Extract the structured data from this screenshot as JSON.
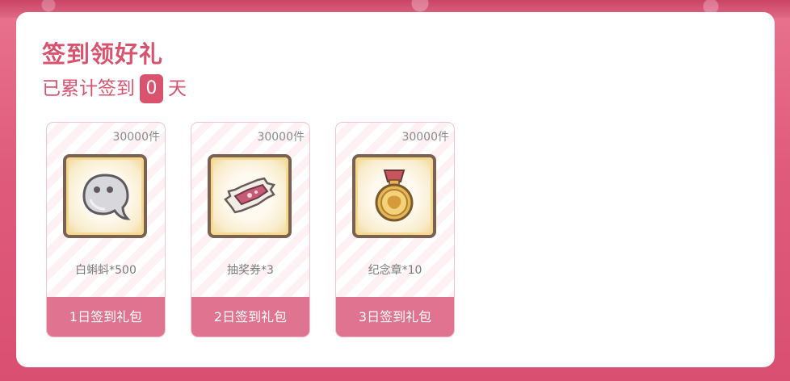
{
  "header": {
    "title": "签到领好礼",
    "subtitle_prefix": "已累计签到",
    "signed_days": "0",
    "subtitle_suffix": "天"
  },
  "rewards": [
    {
      "quantity": "30000件",
      "icon": "tadpole-ghost-icon",
      "name": "白蝌蚪*500",
      "button": "1日签到礼包"
    },
    {
      "quantity": "30000件",
      "icon": "lottery-ticket-icon",
      "name": "抽奖券*3",
      "button": "2日签到礼包"
    },
    {
      "quantity": "30000件",
      "icon": "medal-icon",
      "name": "纪念章*10",
      "button": "3日签到礼包"
    }
  ],
  "colors": {
    "accent": "#d9536f",
    "button": "#e07390",
    "background": "#df5b7b"
  }
}
